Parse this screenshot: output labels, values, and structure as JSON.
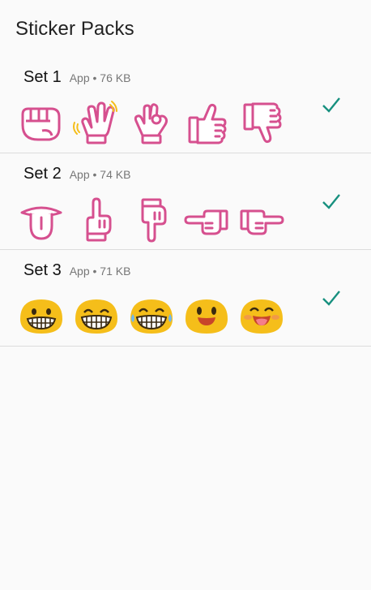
{
  "header": {
    "title": "Sticker Packs"
  },
  "colors": {
    "hand_stroke": "#d6508f",
    "emoji_fill": "#f5be1a",
    "check": "#17907f"
  },
  "packs": [
    {
      "name": "Set 1",
      "meta": "App • 76 KB",
      "installed": true,
      "stickers": [
        "fist-icon",
        "waving-hand-icon",
        "ok-hand-icon",
        "thumbs-up-icon",
        "thumbs-down-icon"
      ]
    },
    {
      "name": "Set 2",
      "meta": "App • 74 KB",
      "installed": true,
      "stickers": [
        "tongue-out-icon",
        "pointing-up-icon",
        "pointing-down-icon",
        "pointing-left-icon",
        "pointing-right-icon"
      ]
    },
    {
      "name": "Set 3",
      "meta": "App • 71 KB",
      "installed": true,
      "stickers": [
        "grinning-face-icon",
        "grinning-squinting-face-icon",
        "laughing-tears-face-icon",
        "smiling-face-icon",
        "winking-tongue-face-icon"
      ]
    }
  ]
}
